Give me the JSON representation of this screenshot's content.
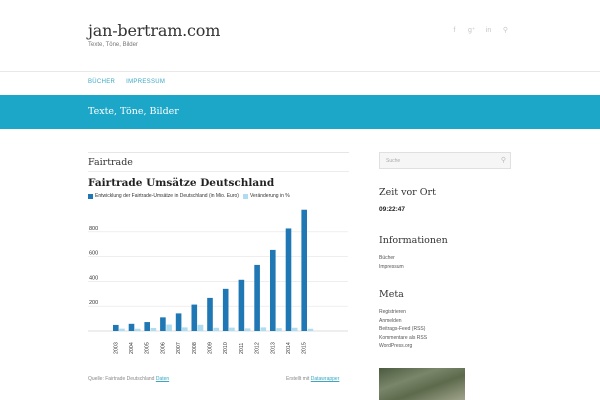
{
  "header": {
    "site_title": "jan-bertram.com",
    "site_description": "Texte, Töne, Bilder",
    "social_icons": [
      "facebook-icon",
      "google-plus-icon",
      "linkedin-icon",
      "search-icon"
    ]
  },
  "nav": {
    "items": [
      {
        "label": "BÜCHER"
      },
      {
        "label": "IMPRESSUM"
      }
    ]
  },
  "banner": {
    "text": "Texte, Töne, Bilder"
  },
  "main": {
    "page_title": "Fairtrade",
    "source_prefix": "Quelle: Fairtrade Deutschland",
    "source_link": "Daten",
    "created_prefix": "Erstellt mit",
    "created_link": "Datawrapper"
  },
  "chart_data": {
    "type": "bar",
    "title": "Fairtrade Umsätze Deutschland",
    "categories": [
      "2003",
      "2004",
      "2005",
      "2006",
      "2007",
      "2008",
      "2009",
      "2010",
      "2011",
      "2012",
      "2013",
      "2014",
      "2015"
    ],
    "series": [
      {
        "name": "Entwicklung der Fairtrade-Umsätze in Deutschland (in Mio. Euro)",
        "color": "#1f77b4",
        "values": [
          49,
          58,
          72,
          110,
          142,
          213,
          267,
          340,
          413,
          533,
          654,
          827,
          978
        ]
      },
      {
        "name": "Veränderung in %",
        "color": "#aedcf0",
        "values": [
          19,
          18,
          24,
          52,
          29,
          50,
          26,
          27,
          21,
          29,
          23,
          26,
          18
        ]
      }
    ],
    "y_ticks": [
      200,
      400,
      600,
      800
    ],
    "ylim": [
      0,
      1000
    ],
    "grid": true,
    "legend_position": "top-left"
  },
  "sidebar": {
    "search_placeholder": "Suche",
    "time_title": "Zeit vor Ort",
    "time_value": "09:22:47",
    "info_title": "Informationen",
    "info_links": [
      "Bücher",
      "Impressum"
    ],
    "meta_title": "Meta",
    "meta_links": [
      "Registrieren",
      "Anmelden",
      "Beitrags-Feed (RSS)",
      "Kommentare als RSS",
      "WordPress.org"
    ]
  },
  "colors": {
    "accent": "#1ca6c7",
    "link": "#3aa8c4",
    "bar_primary": "#1f77b4",
    "bar_secondary": "#aedcf0"
  }
}
